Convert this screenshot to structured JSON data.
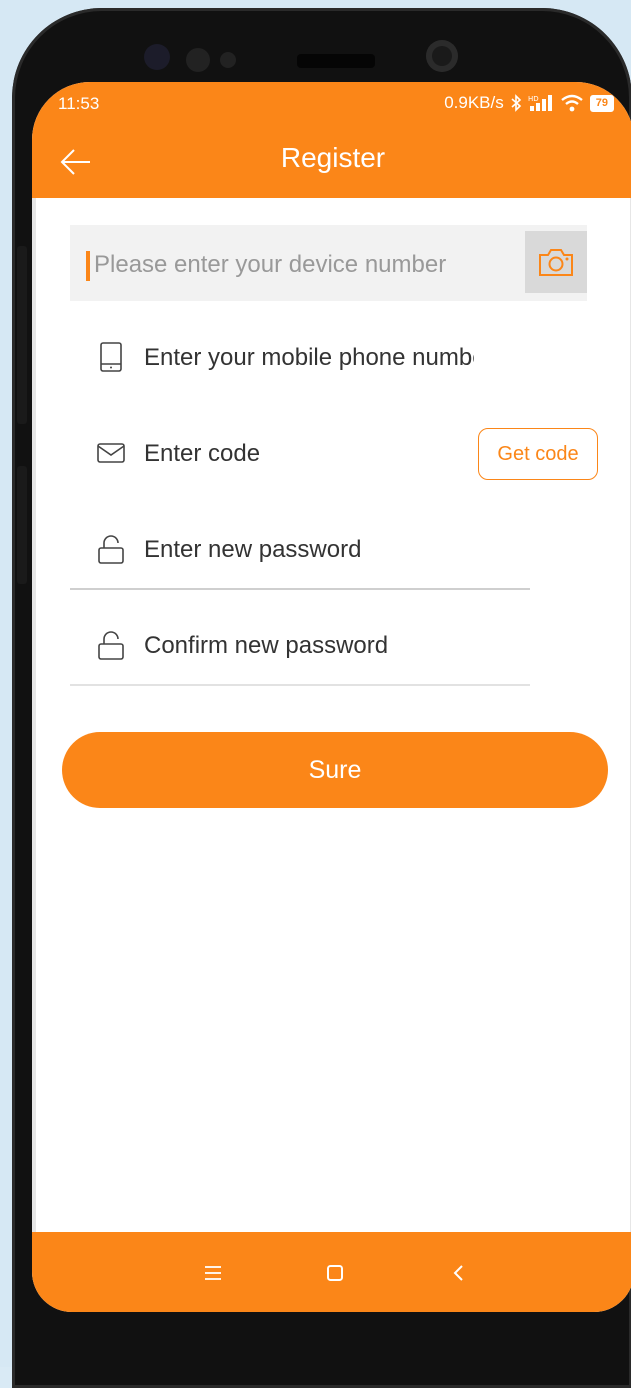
{
  "status_bar": {
    "time": "11:53",
    "net_speed": "0.9KB/s",
    "battery": "79"
  },
  "header": {
    "title": "Register"
  },
  "form": {
    "device_placeholder": "Please enter your device number",
    "phone_placeholder": "Enter your mobile phone number",
    "code_placeholder": "Enter code",
    "get_code_label": "Get code",
    "password_placeholder": "Enter new password",
    "confirm_placeholder": "Confirm new password"
  },
  "actions": {
    "submit_label": "Sure"
  },
  "colors": {
    "accent": "#fb8618",
    "field_bg": "#f2f2f2"
  },
  "icons": {
    "back": "arrow-left-icon",
    "camera": "camera-icon",
    "phone": "mobile-phone-icon",
    "mail": "envelope-icon",
    "lock": "lock-icon",
    "nav_menu": "menu-icon",
    "nav_home": "square-home-icon",
    "nav_back": "chevron-left-icon"
  }
}
